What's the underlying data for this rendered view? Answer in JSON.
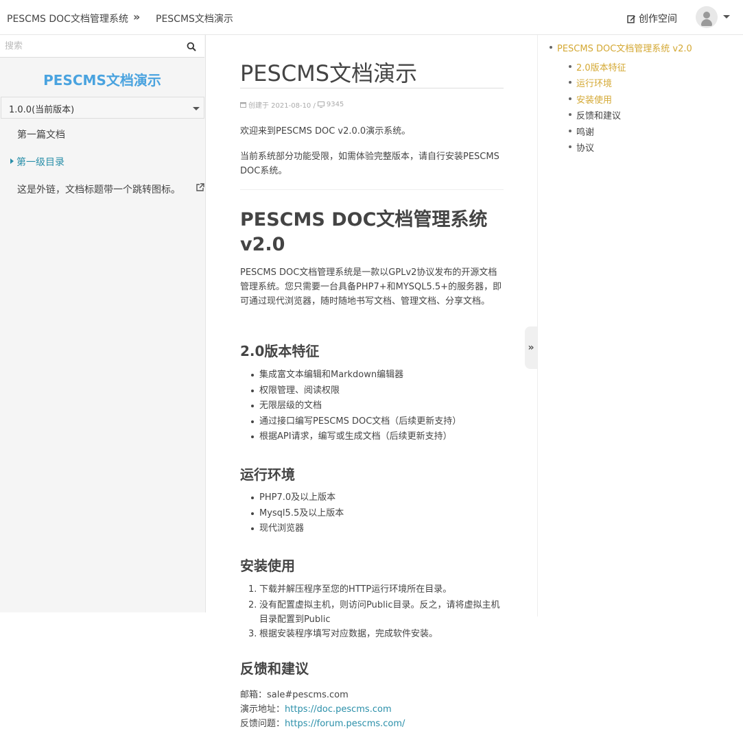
{
  "header": {
    "breadcrumb": [
      "PESCMS DOC文档管理系统",
      "PESCMS文档演示"
    ],
    "separator": "»",
    "create_label": "创作空间"
  },
  "sidebar": {
    "search_placeholder": "搜索",
    "title": "PESCMS文档演示",
    "version": "1.0.0(当前版本)",
    "items": [
      {
        "label": "第一篇文档"
      },
      {
        "label": "第一级目录",
        "active": true
      },
      {
        "label": "这是外链，文档标题带一个跳转图标。",
        "external": true
      }
    ]
  },
  "doc": {
    "title": "PESCMS文档演示",
    "meta_created": "创建于 2021-08-10 /",
    "meta_views": "9345",
    "intro1": "欢迎来到PESCMS DOC v2.0.0演示系统。",
    "intro2": "当前系统部分功能受限，如需体验完整版本，请自行安装PESCMS DOC系统。",
    "h1": "PESCMS DOC文档管理系统 v2.0",
    "desc": "PESCMS DOC文档管理系统是一款以GPLv2协议发布的开源文档管理系统。您只需要一台具备PHP7+和MYSQL5.5+的服务器，即可通过现代浏览器，随时随地书写文档、管理文档、分享文档。",
    "features_title": "2.0版本特征",
    "features": [
      "集成富文本编辑和Markdown编辑器",
      "权限管理、阅读权限",
      "无限层级的文档",
      "通过接口编写PESCMS DOC文档（后续更新支持）",
      "根据API请求，编写或生成文档（后续更新支持）"
    ],
    "env_title": "运行环境",
    "env": [
      "PHP7.0及以上版本",
      "Mysql5.5及以上版本",
      "现代浏览器"
    ],
    "install_title": "安装使用",
    "install": [
      "下载并解压程序至您的HTTP运行环境所在目录。",
      "没有配置虚拟主机，则访问Public目录。反之，请将虚拟主机目录配置到Public",
      "根据安装程序填写对应数据，完成软件安装。"
    ],
    "feedback_title": "反馈和建议",
    "email_label": "邮箱：",
    "email": "sale#pescms.com",
    "demo_label": "演示地址：",
    "demo_url": "https://doc.pescms.com",
    "forum_label": "反馈问题：",
    "forum_url": "https://forum.pescms.com/"
  },
  "toggle": "»",
  "toc": {
    "root": "PESCMS DOC文档管理系统 v2.0",
    "items": [
      {
        "label": "2.0版本特征",
        "color": "#d4a833"
      },
      {
        "label": "运行环境",
        "color": "#d4a833"
      },
      {
        "label": "安装使用",
        "color": "#d4a833"
      },
      {
        "label": "反馈和建议",
        "color": "#444444"
      },
      {
        "label": "鸣谢",
        "color": "#444444"
      },
      {
        "label": "协议",
        "color": "#444444"
      }
    ]
  },
  "icons": {
    "search": "search-icon",
    "edit": "edit-icon",
    "user": "user-icon",
    "external": "external-link-icon",
    "calendar": "calendar-icon",
    "monitor": "monitor-icon"
  }
}
